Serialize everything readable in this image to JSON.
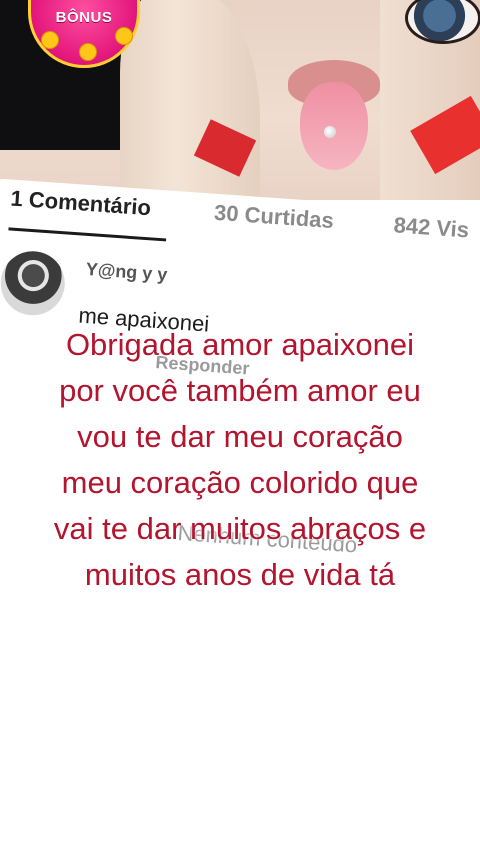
{
  "hero": {
    "badge_label": "BÔNUS",
    "accent_pink": "#e2147a",
    "accent_gold": "#ffcf33"
  },
  "tabs": {
    "comments": "1 Comentário",
    "likes": "30 Curtidas",
    "views": "842 Vis"
  },
  "comment": {
    "username": "Y@ng y y",
    "text": "me apaixonei",
    "reply_label": "Responder",
    "avatar_icon": "user-avatar"
  },
  "empty_state": "Nenhum conteudo",
  "overlay": {
    "lines": [
      "Obrigada amor apaixonei",
      "por você também amor eu",
      "vou te dar meu coração",
      "meu coração colorido que",
      "vai te dar muitos abraços e",
      "muitos anos de vida tá"
    ],
    "color": "#b3142e"
  }
}
